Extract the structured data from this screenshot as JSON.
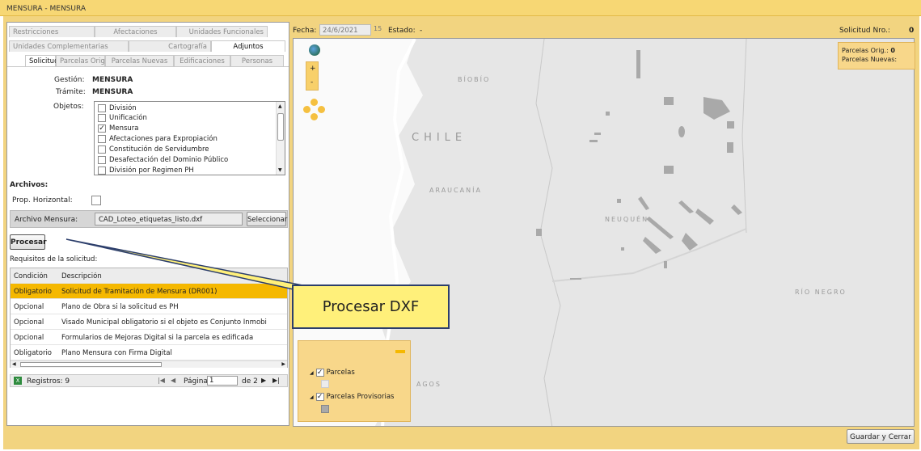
{
  "window_title": "MENSURA - MENSURA",
  "tabs_row1": [
    "Restricciones",
    "Afectaciones",
    "Unidades Funcionales"
  ],
  "tabs_row2": [
    "Unidades Complementarias",
    "Cartografía",
    "Adjuntos"
  ],
  "tabs_row3": [
    "Solicitud",
    "Parcelas Orig.",
    "Parcelas Nuevas",
    "Edificaciones",
    "Personas"
  ],
  "form": {
    "gestion_label": "Gestión:",
    "gestion_value": "MENSURA",
    "tramite_label": "Trámite:",
    "tramite_value": "MENSURA",
    "objetos_label": "Objetos:",
    "objetos": [
      {
        "label": "División",
        "checked": false
      },
      {
        "label": "Unificación",
        "checked": false
      },
      {
        "label": "Mensura",
        "checked": true
      },
      {
        "label": "Afectaciones para Expropiación",
        "checked": false
      },
      {
        "label": "Constitución de Servidumbre",
        "checked": false
      },
      {
        "label": "Desafectación del Dominio Público",
        "checked": false
      },
      {
        "label": "División por Regimen PH",
        "checked": false
      }
    ],
    "archivos_label": "Archivos:",
    "prop_horizontal_label": "Prop. Horizontal:",
    "archivo_mensura_label": "Archivo Mensura:",
    "archivo_mensura_value": "CAD_Loteo_etiquetas_listo.dxf",
    "seleccionar_label": "Seleccionar",
    "procesar_label": "Procesar",
    "requisitos_label": "Requisitos de la solicitud:"
  },
  "grid": {
    "headers": [
      "Condición",
      "Descripción"
    ],
    "rows": [
      {
        "condicion": "Obligatorio",
        "descripcion": "Solicitud de Tramitación de Mensura (DR001)",
        "selected": true
      },
      {
        "condicion": "Opcional",
        "descripcion": "Plano de Obra si la solicitud es PH"
      },
      {
        "condicion": "Opcional",
        "descripcion": "Visado Municipal obligatorio si el objeto es Conjunto Inmobi"
      },
      {
        "condicion": "Opcional",
        "descripcion": "Formularios de Mejoras Digital si la parcela es edificada"
      },
      {
        "condicion": "Obligatorio",
        "descripcion": "Plano Mensura con Firma Digital"
      }
    ],
    "registros": "Registros: 9",
    "pagina_label": "Página",
    "pagina_value": "1",
    "de_label": "de 2"
  },
  "header": {
    "fecha_label": "Fecha:",
    "fecha_value": "24/6/2021",
    "cal_glyph": "15",
    "estado_label": "Estado:",
    "estado_value": "-",
    "solicitud_label": "Solicitud Nro.:",
    "solicitud_value": "0"
  },
  "counts": {
    "orig_label": "Parcelas Orig.:",
    "orig_value": "0",
    "nuevas_label": "Parcelas Nuevas:"
  },
  "map_labels": {
    "biobio": "BÍOBÍO",
    "chile": "CHILE",
    "araucania": "ARAUCANÍA",
    "neuquen": "NEUQUÉN",
    "rionegro": "RÍO NEGRO",
    "lagos": "AGOS"
  },
  "legend": {
    "parcelas": "Parcelas",
    "provisorias": "Parcelas Provisorias"
  },
  "callout": "Procesar DXF",
  "guardar_label": "Guardar y Cerrar",
  "colors": {
    "accent": "#f2d480",
    "selected_row": "#f5b800",
    "callout": "#fff07a"
  }
}
